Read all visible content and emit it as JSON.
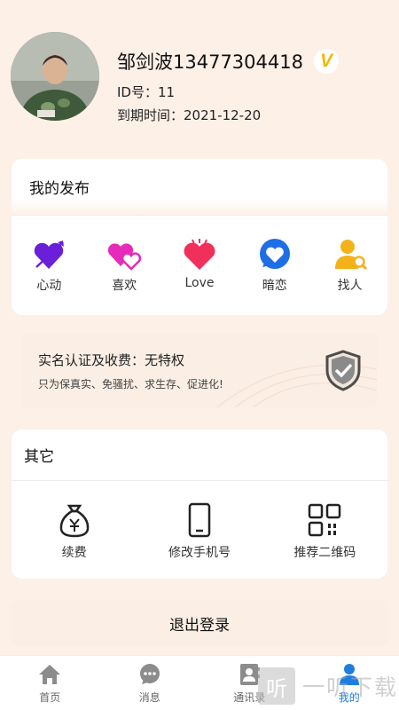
{
  "profile": {
    "name": "邹剑波13477304418",
    "vip_badge": "V",
    "id_line": "ID号：11",
    "expire_line": "到期时间：2021-12-20"
  },
  "publish": {
    "title": "我的发布",
    "items": [
      {
        "label": "心动",
        "icon": "heart-arrow-icon",
        "color": "#6a1fd8"
      },
      {
        "label": "喜欢",
        "icon": "double-heart-icon",
        "color": "#e62ab9"
      },
      {
        "label": "Love",
        "icon": "heart-sparkle-icon",
        "color": "#f0305a"
      },
      {
        "label": "暗恋",
        "icon": "heart-bubble-icon",
        "color": "#1e6ee6"
      },
      {
        "label": "找人",
        "icon": "person-search-icon",
        "color": "#f4b21a"
      }
    ]
  },
  "privilege": {
    "title": "实名认证及收费：无特权",
    "subtitle": "只为保真实、免骚扰、求生存、促进化!",
    "icon": "shield-check-icon"
  },
  "other": {
    "title": "其它",
    "items": [
      {
        "label": "续费",
        "icon": "money-bag-icon"
      },
      {
        "label": "修改手机号",
        "icon": "phone-icon"
      },
      {
        "label": "推荐二维码",
        "icon": "qr-code-icon"
      }
    ]
  },
  "logout_label": "退出登录",
  "tabs": [
    {
      "label": "首页",
      "icon": "home-icon"
    },
    {
      "label": "消息",
      "icon": "message-icon"
    },
    {
      "label": "通讯录",
      "icon": "contacts-icon"
    },
    {
      "label": "我的",
      "icon": "user-icon",
      "active": true
    }
  ],
  "watermark": {
    "box": "听",
    "text": "一听下载"
  },
  "colors": {
    "accent": "#1f7de0",
    "background": "#fdf0e7",
    "vip": "#f2b705"
  }
}
